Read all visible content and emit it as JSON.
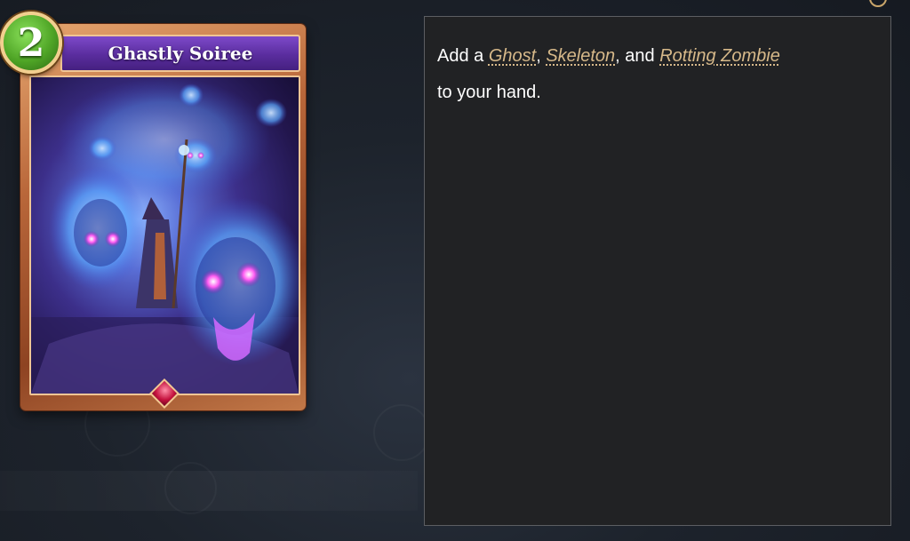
{
  "card": {
    "cost": "2",
    "name": "Ghastly Soiree",
    "art_icon": "ghost-skull-art",
    "frame_color": "#b9673a",
    "cost_gem_color": "#4fa526"
  },
  "description": {
    "prefix": "Add a ",
    "keyword_1": "Ghost",
    "sep_1": ", ",
    "keyword_2": "Skeleton",
    "sep_2": ", and ",
    "keyword_3": "Rotting Zombie",
    "suffix": "to your hand.",
    "keyword_color": "#d7b98a"
  }
}
